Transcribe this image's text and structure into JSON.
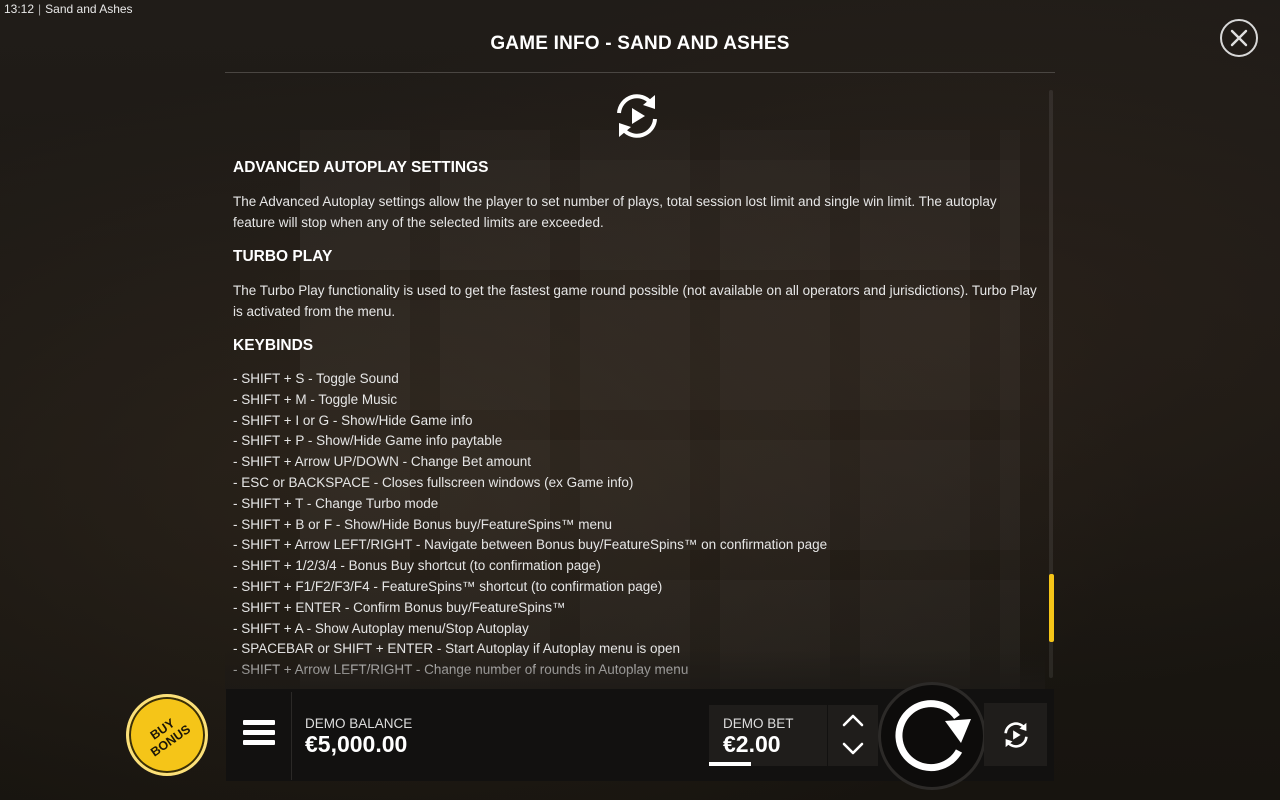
{
  "status_bar": {
    "time": "13:12",
    "app_name": "Sand and Ashes"
  },
  "header": {
    "title": "GAME INFO - SAND AND ASHES"
  },
  "icons": {
    "close": "close-icon",
    "section": "autoplay-icon",
    "menu": "hamburger-menu-icon",
    "spin": "spin-icon",
    "autoplay": "autoplay-icon"
  },
  "colors": {
    "accent": "#f5c518",
    "background": "#1c1916",
    "bar": "#121110"
  },
  "sections": {
    "advanced_autoplay": {
      "heading": "ADVANCED AUTOPLAY SETTINGS",
      "body": "The Advanced Autoplay settings allow the player to set number of plays, total session lost limit and single win limit. The autoplay feature will stop when any of the selected limits are exceeded."
    },
    "turbo_play": {
      "heading": "TURBO PLAY",
      "body": "The Turbo Play functionality is used to get the fastest game round possible (not available on all operators and jurisdictions). Turbo Play is activated from the menu."
    },
    "keybinds": {
      "heading": "KEYBINDS",
      "items": [
        "- SHIFT + S - Toggle Sound",
        "- SHIFT + M - Toggle Music",
        "- SHIFT + I or G - Show/Hide Game info",
        "- SHIFT + P - Show/Hide Game info paytable",
        "- SHIFT + Arrow UP/DOWN - Change Bet amount",
        "- ESC or BACKSPACE - Closes fullscreen windows (ex Game info)",
        "- SHIFT + T - Change Turbo mode",
        "- SHIFT + B or F - Show/Hide Bonus buy/FeatureSpins™ menu",
        "- SHIFT + Arrow LEFT/RIGHT - Navigate between Bonus buy/FeatureSpins™ on confirmation page",
        "- SHIFT + 1/2/3/4 - Bonus Buy shortcut (to confirmation page)",
        "- SHIFT + F1/F2/F3/F4 - FeatureSpins™ shortcut (to confirmation page)",
        "- SHIFT + ENTER - Confirm Bonus buy/FeatureSpins™",
        "- SHIFT + A - Show Autoplay menu/Stop Autoplay",
        "- SPACEBAR or SHIFT + ENTER - Start Autoplay if Autoplay menu is open",
        "- SHIFT + Arrow LEFT/RIGHT - Change number of rounds in Autoplay menu"
      ]
    }
  },
  "bottom_bar": {
    "buy_bonus_line1": "BUY",
    "buy_bonus_line2": "BONUS",
    "balance_label": "DEMO BALANCE",
    "balance_value": "€5,000.00",
    "bet_label": "DEMO BET",
    "bet_value": "€2.00"
  }
}
